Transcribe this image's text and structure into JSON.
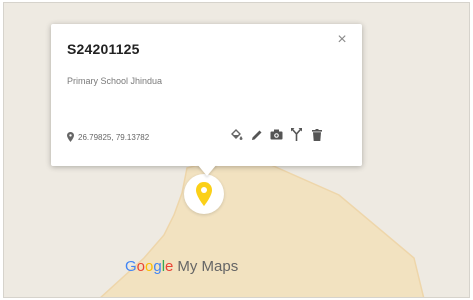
{
  "popup": {
    "title": "S24201125",
    "description": "Primary School Jhindua",
    "coordinates": "26.79825, 79.13782",
    "close_symbol": "×",
    "icons": [
      "pin-icon",
      "paint-bucket-icon",
      "pencil-icon",
      "camera-icon",
      "directions-icon",
      "trash-icon"
    ]
  },
  "map": {
    "polygon_fill": "#f3e2bf",
    "polygon_stroke": "#eed5a8",
    "marker_color": "#fbd018"
  },
  "brand": {
    "google": [
      "G",
      "o",
      "o",
      "g",
      "l",
      "e"
    ],
    "product": "My Maps"
  }
}
